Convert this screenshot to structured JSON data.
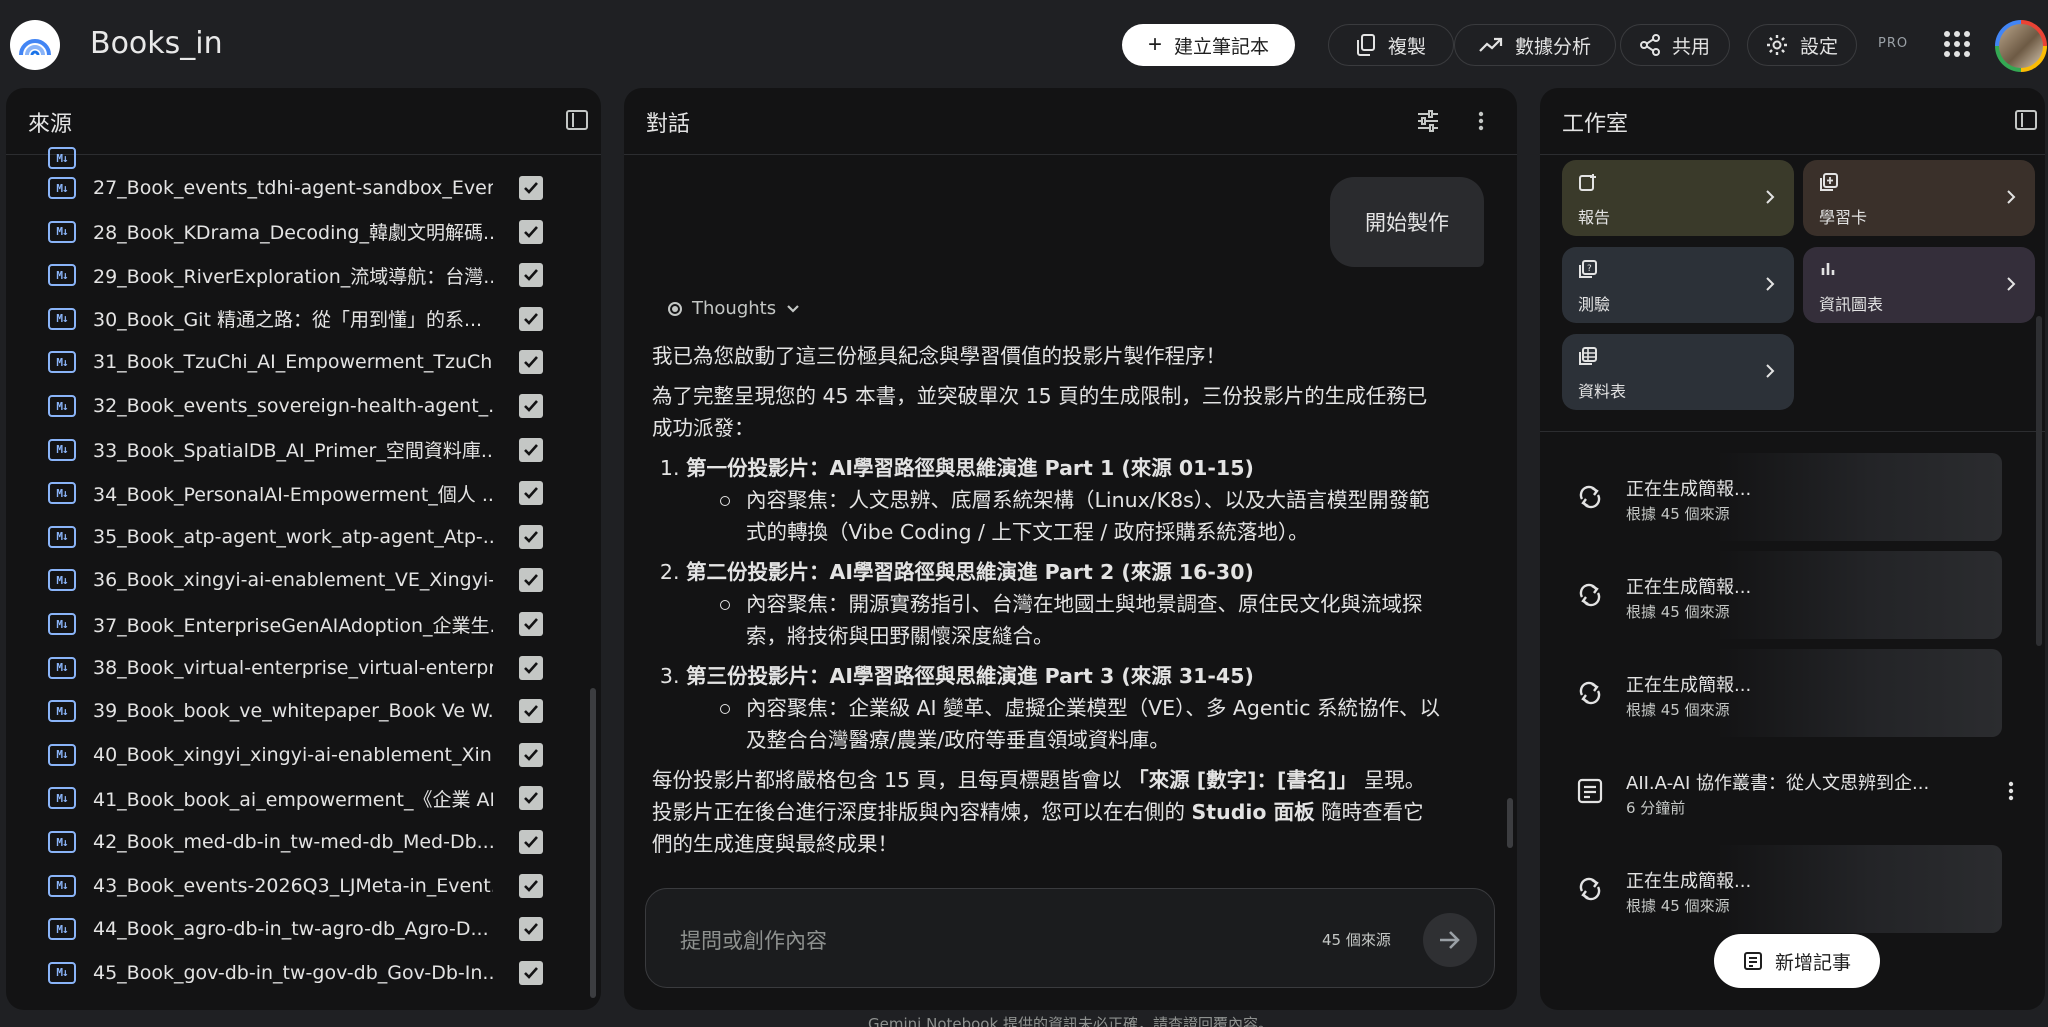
{
  "header": {
    "app_title": "Books_in",
    "create_notebook": "建立筆記本",
    "copy": "複製",
    "analytics": "數據分析",
    "share": "共用",
    "settings": "設定",
    "pro_badge": "PRO"
  },
  "sources_panel": {
    "title": "來源",
    "items": [
      {
        "label": "27_Book_events_tdhi-agent-sandbox_Even..."
      },
      {
        "label": "28_Book_KDrama_Decoding_韓劇文明解碼..."
      },
      {
        "label": "29_Book_RiverExploration_流域導航：台灣..."
      },
      {
        "label": "30_Book_Git 精通之路：從「用到懂」的系..."
      },
      {
        "label": "31_Book_TzuChi_AI_Empowerment_TzuChi..."
      },
      {
        "label": "32_Book_events_sovereign-health-agent_..."
      },
      {
        "label": "33_Book_SpatialDB_AI_Primer_空間資料庫..."
      },
      {
        "label": "34_Book_PersonalAI-Empowerment_個人 ..."
      },
      {
        "label": "35_Book_atp-agent_work_atp-agent_Atp-..."
      },
      {
        "label": "36_Book_xingyi-ai-enablement_VE_Xingyi-..."
      },
      {
        "label": "37_Book_EnterpriseGenAIAdoption_企業生..."
      },
      {
        "label": "38_Book_virtual-enterprise_virtual-enterpri..."
      },
      {
        "label": "39_Book_book_ve_whitepaper_Book Ve W..."
      },
      {
        "label": "40_Book_xingyi_xingyi-ai-enablement_Xin..."
      },
      {
        "label": "41_Book_book_ai_empowerment_《企業 AI..."
      },
      {
        "label": "42_Book_med-db-in_tw-med-db_Med-Db..."
      },
      {
        "label": "43_Book_events-2026Q3_LJMeta-in_Event..."
      },
      {
        "label": "44_Book_agro-db-in_tw-agro-db_Agro-D..."
      },
      {
        "label": "45_Book_gov-db-in_tw-gov-db_Gov-Db-In..."
      }
    ]
  },
  "chat_panel": {
    "title": "對話",
    "user_message": "開始製作",
    "thoughts_label": "Thoughts",
    "intro": "我已為您啟動了這三份極具紀念與學習價值的投影片製作程序！",
    "para1": "為了完整呈現您的 45 本書，並突破單次 15 頁的生成限制，三份投影片的生成任務已成功派發：",
    "list": [
      {
        "title": "第一份投影片：AI學習路徑與思維演進 Part 1 (來源 01-15)",
        "detail": "內容聚焦：人文思辨、底層系統架構（Linux/K8s）、以及大語言模型開發範式的轉換（Vibe Coding / 上下文工程 / 政府採購系統落地）。"
      },
      {
        "title": "第二份投影片：AI學習路徑與思維演進 Part 2 (來源 16-30)",
        "detail": "內容聚焦：開源實務指引、台灣在地國土與地景調查、原住民文化與流域探索，將技術與田野關懷深度縫合。"
      },
      {
        "title": "第三份投影片：AI學習路徑與思維演進 Part 3 (來源 31-45)",
        "detail": "內容聚焦：企業級 AI 變革、虛擬企業模型（VE）、多 Agentic 系統協作、以及整合台灣醫療/農業/政府等垂直領域資料庫。"
      }
    ],
    "closing_a": "每份投影片都將嚴格包含 15 頁，且每頁標題皆會以",
    "closing_b": "「來源 [數字]：[書名]」",
    "closing_c": "呈現。投影片正在後台進行深度排版與內容精煉，您可以在右側的",
    "closing_d": "Studio 面板",
    "closing_e": "隨時查看它們的生成進度與最終成果！",
    "input_placeholder": "提問或創作內容",
    "source_count": "45 個來源",
    "disclaimer": "Gemini Notebook 提供的資訊未必正確，請查證回覆內容。"
  },
  "studio_panel": {
    "title": "工作室",
    "cards": [
      {
        "label": "報告",
        "color": "#3a3a2a"
      },
      {
        "label": "學習卡",
        "color": "#3a302a"
      },
      {
        "label": "測驗",
        "color": "#2c3138"
      },
      {
        "label": "資訊圖表",
        "color": "#342e3a"
      },
      {
        "label": "資料表",
        "color": "#2c3138"
      }
    ],
    "notes": [
      {
        "title": "正在生成簡報...",
        "subtitle": "根據 45 個來源"
      },
      {
        "title": "正在生成簡報...",
        "subtitle": "根據 45 個來源"
      },
      {
        "title": "正在生成簡報...",
        "subtitle": "根據 45 個來源"
      },
      {
        "title": "AII.A-AI 協作叢書：從人文思辨到企...",
        "subtitle": "6 分鐘前"
      },
      {
        "title": "正在生成簡報...",
        "subtitle": "根據 45 個來源"
      }
    ],
    "add_note": "新增記事"
  }
}
